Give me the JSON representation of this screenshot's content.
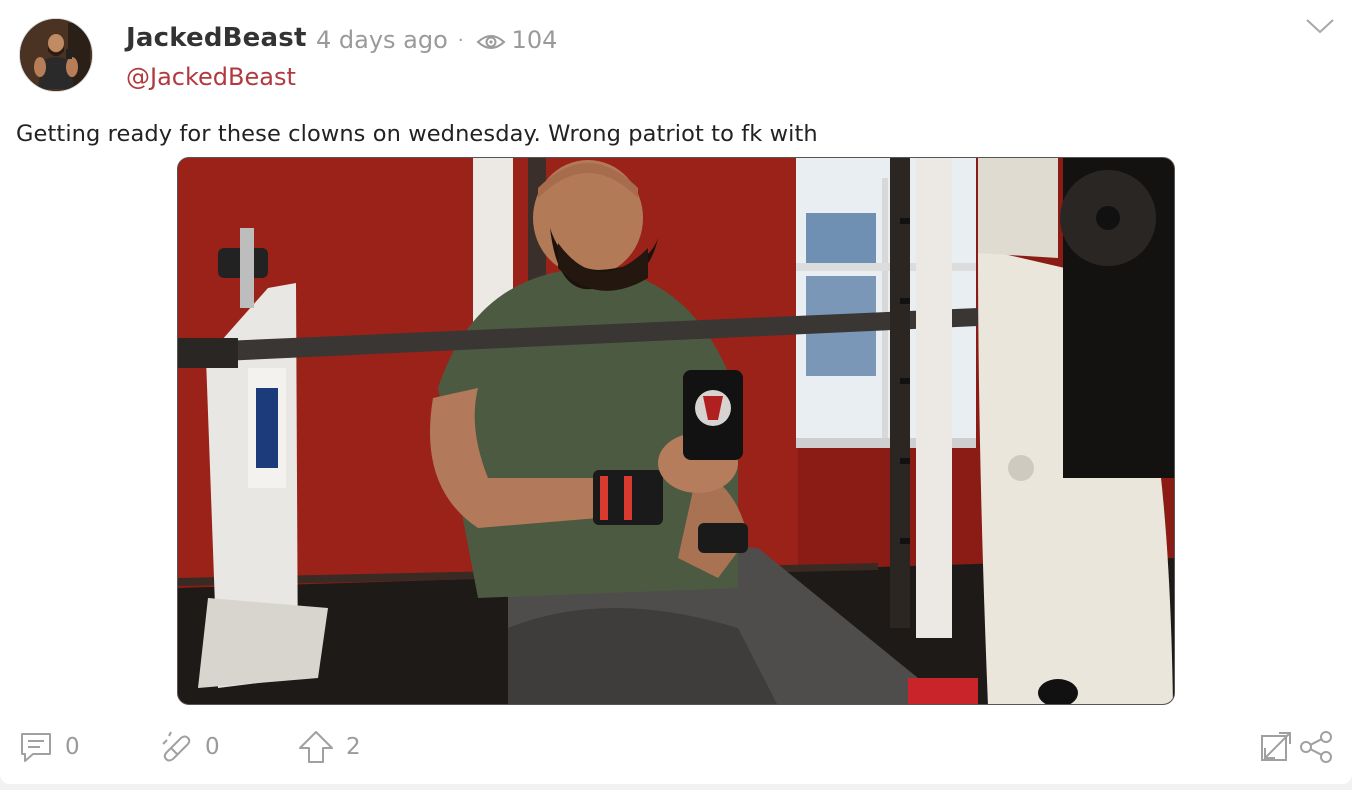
{
  "post": {
    "username": "JackedBeast",
    "handle": "@JackedBeast",
    "timestamp": "4 days ago",
    "separator": "·",
    "views": "104",
    "text": "Getting ready for these clowns on wednesday. Wrong patriot to fk with"
  },
  "actions": {
    "comments": "0",
    "reposts": "0",
    "upvotes": "2"
  },
  "icons": {
    "views": "eye-icon",
    "menu": "chevron-down-icon",
    "comment": "comment-icon",
    "repost": "repost-icon",
    "upvote": "arrow-up-icon",
    "expand": "expand-icon",
    "share": "share-icon"
  },
  "colors": {
    "handle": "#b03a3e",
    "muted": "#9a9a9a",
    "text": "#222222"
  }
}
